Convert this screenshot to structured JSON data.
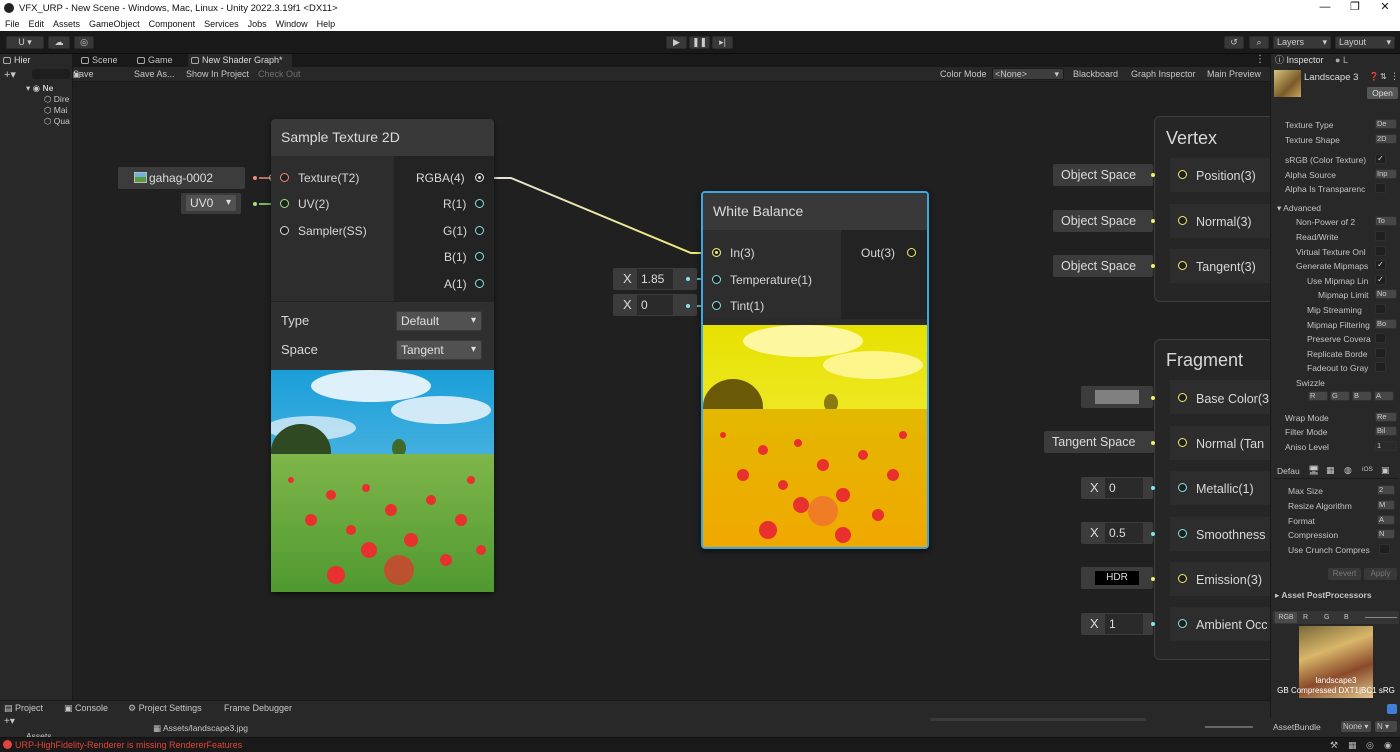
{
  "window": {
    "title": "VFX_URP - New Scene - Windows, Mac, Linux - Unity 2022.3.19f1 <DX11>",
    "minimize": "—",
    "restore": "❐",
    "close": "✕"
  },
  "menu": [
    "File",
    "Edit",
    "Assets",
    "GameObject",
    "Component",
    "Services",
    "Jobs",
    "Window",
    "Help"
  ],
  "toolbar": {
    "account": "U ▾",
    "layers": "Layers",
    "layout": "Layout"
  },
  "tabs": {
    "hierarchy": "Hier",
    "scene": "Scene",
    "game": "Game",
    "shader_graph": "New Shader Graph*",
    "inspector": "Inspector",
    "lighting": "L"
  },
  "hierarchy": {
    "scene": "Ne",
    "items": [
      "Dire",
      "Mai",
      "Qua"
    ]
  },
  "sg_toolbar": {
    "save_asset": "Save Asset",
    "save_as": "Save As...",
    "show_in_project": "Show In Project",
    "check_out": "Check Out",
    "color_mode_label": "Color Mode",
    "color_mode_value": "<None>",
    "blackboard": "Blackboard",
    "graph_inspector": "Graph Inspector",
    "main_preview": "Main Preview"
  },
  "sample_texture": {
    "title": "Sample Texture 2D",
    "inputs": [
      "Texture(T2)",
      "UV(2)",
      "Sampler(SS)"
    ],
    "outputs": [
      "RGBA(4)",
      "R(1)",
      "G(1)",
      "B(1)",
      "A(1)"
    ],
    "type_label": "Type",
    "type_value": "Default",
    "space_label": "Space",
    "space_value": "Tangent",
    "texture_input": "gahag-0002",
    "uv_input": "UV0"
  },
  "white_balance": {
    "title": "White Balance",
    "inputs": [
      "In(3)",
      "Temperature(1)",
      "Tint(1)"
    ],
    "output": "Out(3)",
    "temp_axis": "X",
    "temperature": "1.85",
    "tint_axis": "X",
    "tint": "0"
  },
  "vertex": {
    "title": "Vertex",
    "ports": [
      "Position(3)",
      "Normal(3)",
      "Tangent(3)"
    ],
    "spaces": [
      "Object Space",
      "Object Space",
      "Object Space"
    ]
  },
  "fragment": {
    "title": "Fragment",
    "ports": [
      "Base Color(3",
      "Normal (Tan",
      "Metallic(1)",
      "Smoothness",
      "Emission(3)",
      "Ambient Occ"
    ],
    "normal_space": "Tangent Space",
    "hdr": "HDR",
    "axis": "X",
    "metallic": "0",
    "smoothness": "0.5",
    "ambient": "1"
  },
  "inspector": {
    "asset_name": "Landscape 3",
    "open": "Open",
    "rows": [
      {
        "label": "Texture Type",
        "value": "De"
      },
      {
        "label": "Texture Shape",
        "value": "2D"
      },
      {
        "label": "sRGB (Color Texture)",
        "check": "✓"
      },
      {
        "label": "Alpha Source",
        "value": "Inp"
      },
      {
        "label": "Alpha Is Transparenc",
        "check": ""
      }
    ],
    "advanced": "Advanced",
    "adv_rows": [
      {
        "label": "Non-Power of 2",
        "value": "To"
      },
      {
        "label": "Read/Write",
        "check": ""
      },
      {
        "label": "Virtual Texture Onl",
        "check": ""
      },
      {
        "label": "Generate Mipmaps",
        "check": "✓"
      },
      {
        "label": "Use Mipmap Lin",
        "check": "✓"
      },
      {
        "label": "Mipmap Limit",
        "value": "No"
      },
      {
        "label": "Mip Streaming",
        "check": ""
      },
      {
        "label": "Mipmap Filtering",
        "value": "Bo"
      },
      {
        "label": "Preserve Covera",
        "check": ""
      },
      {
        "label": "Replicate Borde",
        "check": ""
      },
      {
        "label": "Fadeout to Gray",
        "check": ""
      }
    ],
    "swizzle": "Swizzle",
    "swizzle_values": [
      "R",
      "G",
      "B",
      "A"
    ],
    "wrap_rows": [
      {
        "label": "Wrap Mode",
        "value": "Re"
      },
      {
        "label": "Filter Mode",
        "value": "Bil"
      },
      {
        "label": "Aniso Level",
        "value": "1"
      }
    ],
    "platform_default": "Defau",
    "platform_rows": [
      {
        "label": "Max Size",
        "value": "2"
      },
      {
        "label": "Resize Algorithm",
        "value": "M"
      },
      {
        "label": "Format",
        "value": "A"
      },
      {
        "label": "Compression",
        "value": "N"
      },
      {
        "label": "Use Crunch Compres",
        "check": ""
      }
    ],
    "revert": "Revert",
    "apply": "Apply",
    "post_processors": "Asset PostProcessors",
    "channels": [
      "RGB",
      "R",
      "G",
      "B"
    ],
    "preview_name": "landscape3",
    "preview_info": "GB Compressed DXT1|BC1 sRG",
    "asset_bundle": "AssetBundle",
    "asset_bundle_value": "None",
    "asset_bundle_variant": "N"
  },
  "bottom_tabs": [
    "Project",
    "Console",
    "Project Settings",
    "Frame Debugger"
  ],
  "bottom": {
    "assets": "Assets",
    "path": "Assets/landscape3.jpg"
  },
  "status": {
    "message": "URP-HighFidelity-Renderer is missing RendererFeatures"
  },
  "colors": {
    "error": "#e0463b",
    "selection": "#3fa7e0",
    "vec1": "#84e4e7",
    "vec3": "#f0ed6a",
    "vec2": "#9ee57a",
    "texture": "#f08a7a"
  }
}
